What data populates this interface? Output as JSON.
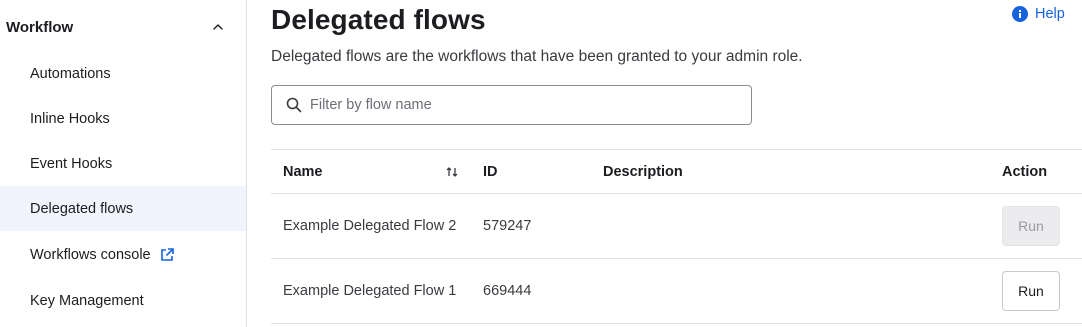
{
  "sidebar": {
    "section_title": "Workflow",
    "items": [
      {
        "label": "Automations"
      },
      {
        "label": "Inline Hooks"
      },
      {
        "label": "Event Hooks"
      },
      {
        "label": "Delegated flows",
        "active": true
      },
      {
        "label": "Workflows console",
        "external": true
      },
      {
        "label": "Key Management"
      }
    ]
  },
  "header": {
    "title": "Delegated flows",
    "subtitle": "Delegated flows are the workflows that have been granted to your admin role.",
    "help_label": "Help"
  },
  "search": {
    "placeholder": "Filter by flow name",
    "value": ""
  },
  "table": {
    "columns": {
      "name": "Name",
      "id": "ID",
      "description": "Description",
      "action": "Action"
    },
    "rows": [
      {
        "name": "Example Delegated Flow 2",
        "id": "579247",
        "description": "",
        "action_label": "Run",
        "action_enabled": false
      },
      {
        "name": "Example Delegated Flow 1",
        "id": "669444",
        "description": "",
        "action_label": "Run",
        "action_enabled": true
      }
    ]
  },
  "colors": {
    "accent": "#1662dd",
    "active_bg": "#f1f4fc",
    "border": "#e1e1e4"
  },
  "icons": [
    "chevron-up-icon",
    "external-link-icon",
    "info-icon",
    "search-icon",
    "sort-icon"
  ]
}
